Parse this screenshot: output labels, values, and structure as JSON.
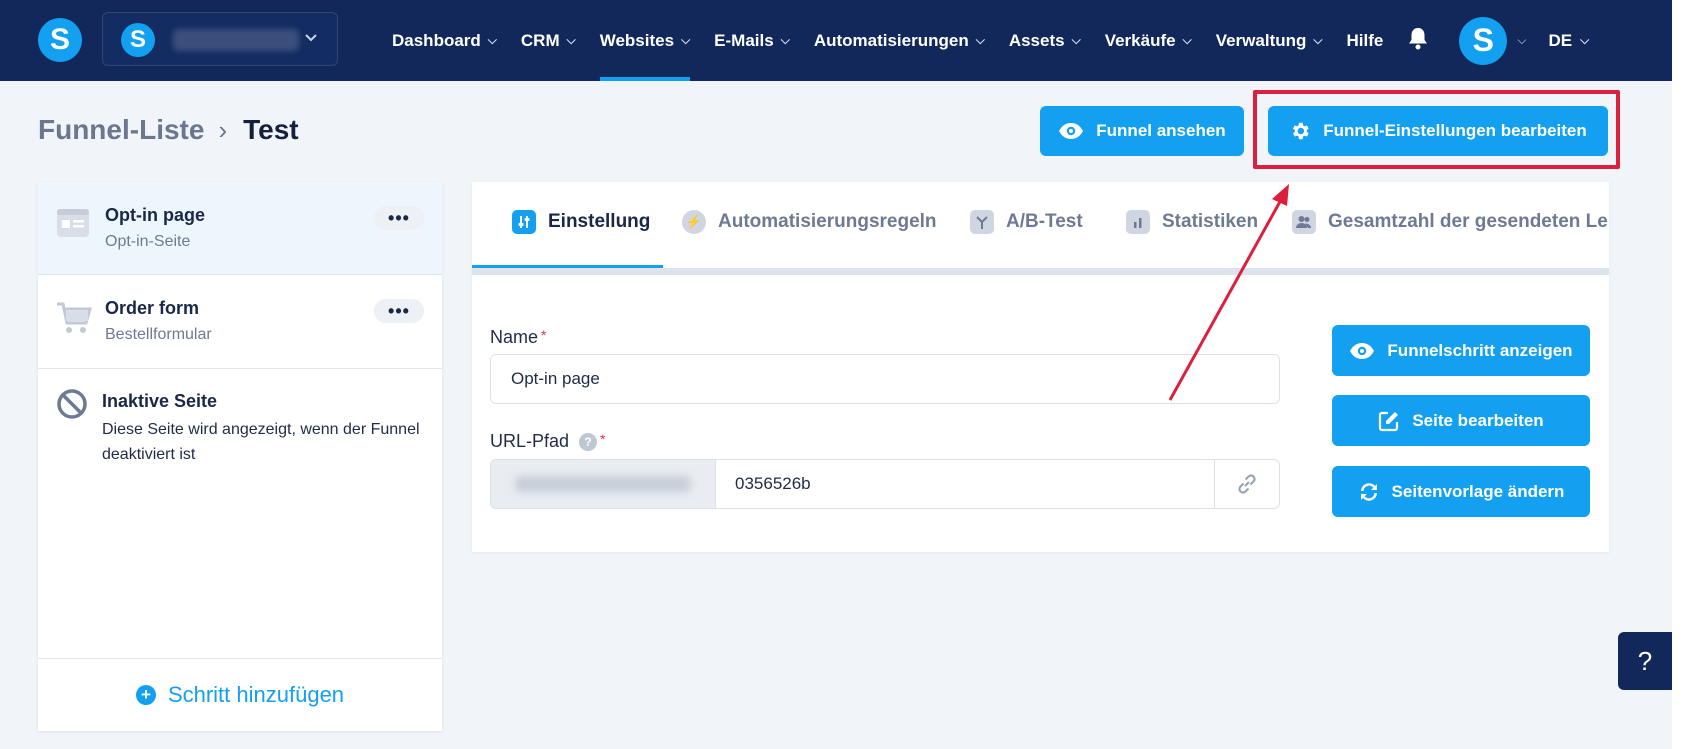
{
  "brand": {
    "logo_letter": "S",
    "account_letter": "S"
  },
  "nav": {
    "items": [
      {
        "label": "Dashboard"
      },
      {
        "label": "CRM"
      },
      {
        "label": "Websites",
        "active": true
      },
      {
        "label": "E-Mails"
      },
      {
        "label": "Automatisierungen"
      },
      {
        "label": "Assets"
      },
      {
        "label": "Verkäufe"
      },
      {
        "label": "Verwaltung"
      }
    ],
    "help_label": "Hilfe",
    "avatar_letter": "S",
    "language": "DE"
  },
  "breadcrumb": {
    "parent": "Funnel-Liste",
    "current": "Test"
  },
  "header_buttons": {
    "view_funnel": "Funnel ansehen",
    "edit_funnel_settings": "Funnel-Einstellungen bearbeiten"
  },
  "steps": [
    {
      "title": "Opt-in page",
      "subtitle": "Opt-in-Seite",
      "more": "•••"
    },
    {
      "title": "Order form",
      "subtitle": "Bestellformular",
      "more": "•••"
    }
  ],
  "inactive_page": {
    "title": "Inaktive Seite",
    "description": "Diese Seite wird angezeigt, wenn der Funnel deaktiviert ist"
  },
  "add_step_label": "Schritt hinzufügen",
  "tabs": [
    {
      "label": "Einstellung",
      "active": true
    },
    {
      "label": "Automatisierungsregeln"
    },
    {
      "label": "A/B-Test"
    },
    {
      "label": "Statistiken"
    },
    {
      "label": "Gesamtzahl der gesendeten Le"
    }
  ],
  "form": {
    "name_label": "Name",
    "name_value": "Opt-in page",
    "url_label": "URL-Pfad",
    "url_value": "0356526b",
    "required_mark": "*",
    "help_mark": "?"
  },
  "side_buttons": {
    "show_step": "Funnelschritt anzeigen",
    "edit_page": "Seite bearbeiten",
    "change_template": "Seitenvorlage ändern"
  },
  "help_fab": "?",
  "colors": {
    "primary": "#13a0f0",
    "nav_bg": "#12285a",
    "highlight": "#dc1f3c"
  }
}
